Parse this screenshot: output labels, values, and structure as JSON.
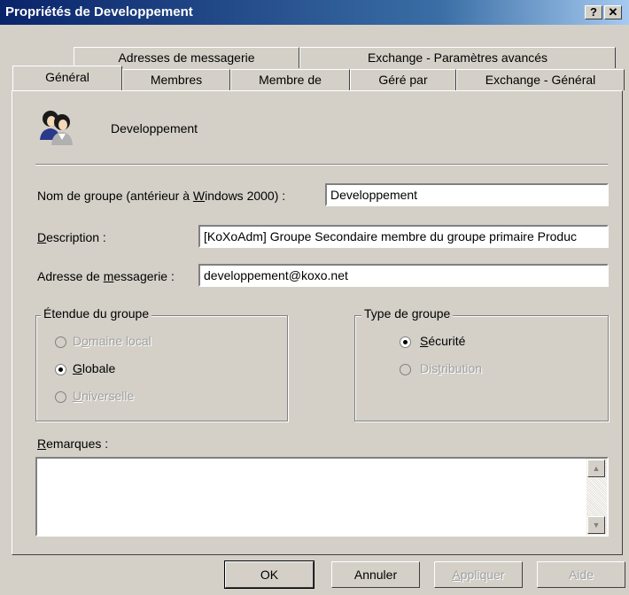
{
  "window": {
    "title": "Propriétés de Developpement",
    "help_btn": "?",
    "close_btn": "✕"
  },
  "tabs_back": [
    "Adresses de messagerie",
    "Exchange - Paramètres avancés"
  ],
  "tabs_front": [
    "Général",
    "Membres",
    "Membre de",
    "Géré par",
    "Exchange - Général"
  ],
  "group": {
    "name": "Developpement",
    "icon": "group-users-icon"
  },
  "form": {
    "prew2k_label_pre": "Nom de groupe (antérieur à ",
    "prew2k_label_u": "W",
    "prew2k_label_post": "indows 2000) :",
    "prew2k_value": "Developpement",
    "description_label_u": "D",
    "description_label_rest": "escription :",
    "description_value": "[KoXoAdm] Groupe Secondaire membre du groupe primaire Produc",
    "email_label_pre": "Adresse de ",
    "email_label_u": "m",
    "email_label_post": "essagerie :",
    "email_value": "developpement@koxo.net"
  },
  "scope": {
    "legend": "Étendue du groupe",
    "options": [
      {
        "pre": "D",
        "u": "o",
        "post": "maine local",
        "checked": false,
        "disabled": true
      },
      {
        "pre": "",
        "u": "G",
        "post": "lobale",
        "checked": true,
        "disabled": false
      },
      {
        "pre": "",
        "u": "U",
        "post": "niverselle",
        "checked": false,
        "disabled": true
      }
    ]
  },
  "type": {
    "legend": "Type de groupe",
    "options": [
      {
        "pre": "",
        "u": "S",
        "post": "écurité",
        "checked": true,
        "disabled": false
      },
      {
        "pre": "Dis",
        "u": "t",
        "post": "ribution",
        "checked": false,
        "disabled": true
      }
    ]
  },
  "notes": {
    "label_u": "R",
    "label_rest": "emarques :",
    "value": "",
    "scroll_up": "▲",
    "scroll_down": "▼"
  },
  "buttons": {
    "ok": "OK",
    "cancel": "Annuler",
    "apply_pre": "",
    "apply_u": "A",
    "apply_post": "ppliquer",
    "help": "Aide"
  }
}
